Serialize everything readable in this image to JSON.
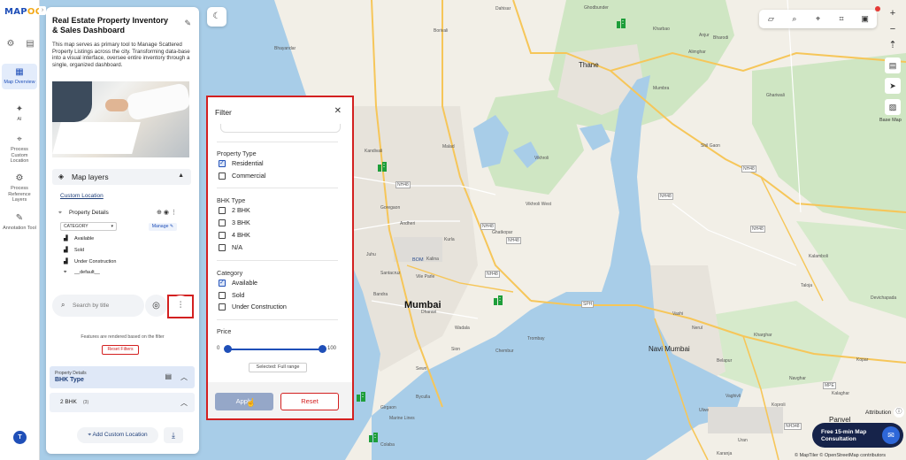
{
  "app": {
    "logo_main": "MAP",
    "logo_accent": "OG"
  },
  "rail": {
    "items": [
      {
        "label": "Map Overview",
        "icon": "map-icon"
      },
      {
        "label": "AI",
        "icon": "ai-icon"
      },
      {
        "label": "Process Custom Location",
        "icon": "location-icon"
      },
      {
        "label": "Process Reference Layers",
        "icon": "layers-process-icon"
      },
      {
        "label": "Annotation Tool",
        "icon": "annotation-icon"
      }
    ],
    "avatar": "T"
  },
  "panel": {
    "title": "Real Estate Property Inventory & Sales Dashboard",
    "description": "This map serves as primary tool to Manage Scattered Property Listings across the city. Transforming data-base into a visual interface, oversee entire inventory through a single, organized dashboard.",
    "map_layers_label": "Map layers",
    "custom_location_label": "Custom Location",
    "layer_name": "Property Details",
    "category_select": "CATEGORY",
    "manage_label": "Manage",
    "legend": [
      "Available",
      "Sold",
      "Under Construction",
      "__default__"
    ],
    "search_placeholder": "Search by title",
    "features_note": "Features are rendered based on the filter",
    "reset_filters_label": "Reset Filters",
    "property_details_small": "Property Details",
    "bhk_type_label": "BHK Type",
    "bhk_row_label": "2 BHK",
    "bhk_row_count": "(3)",
    "add_custom_location_label": "Add Custom Location"
  },
  "filter": {
    "title": "Filter",
    "groups": [
      {
        "label": "Property Type",
        "options": [
          {
            "label": "Residential",
            "checked": true
          },
          {
            "label": "Commercial",
            "checked": false
          }
        ]
      },
      {
        "label": "BHK Type",
        "options": [
          {
            "label": "2 BHK",
            "checked": false
          },
          {
            "label": "3 BHK",
            "checked": false
          },
          {
            "label": "4 BHK",
            "checked": false
          },
          {
            "label": "N/A",
            "checked": false
          }
        ]
      },
      {
        "label": "Category",
        "options": [
          {
            "label": "Available",
            "checked": true
          },
          {
            "label": "Sold",
            "checked": false
          },
          {
            "label": "Under Construction",
            "checked": false
          }
        ]
      }
    ],
    "price_label": "Price",
    "price_min": "0",
    "price_max": "100",
    "price_range": [
      0,
      100
    ],
    "selected_range": "Selected: Full range",
    "apply_label": "Apply",
    "reset_label": "Reset"
  },
  "map": {
    "cities": [
      {
        "name": "Thane",
        "big": false
      },
      {
        "name": "Mumbai",
        "big": true
      },
      {
        "name": "Navi Mumbai",
        "big": false
      },
      {
        "name": "Panvel",
        "big": false
      }
    ],
    "places": [
      "Dahisar",
      "Borivali",
      "Ghodbunder",
      "Kharbao",
      "Anjur",
      "Bharodi",
      "Alimghar",
      "Mumbra",
      "Ghariwali",
      "Shil Gaon",
      "Kandivali",
      "Malad",
      "Bhayandar",
      "Goregaon",
      "Vikhroli",
      "Vikhroli West",
      "Ghatkopar",
      "Kurla",
      "Dharavi",
      "Wadala",
      "Vashi",
      "Nerul",
      "Kharghar",
      "Taloja",
      "Kalamboli",
      "Devichapada",
      "Ulwe",
      "Uran",
      "Vaghivli",
      "Belapur",
      "Koproli",
      "Navghar",
      "Kalaghar",
      "Kopar",
      "Karanja",
      "Sewri",
      "Colaba",
      "Marine Lines",
      "Byculla",
      "Girgaon",
      "Kalina",
      "Bandra",
      "Santacruz",
      "Andheri",
      "Juhu",
      "Vile Parle",
      "Sion",
      "Chembur",
      "Trombay"
    ],
    "road_badges": [
      "NH48",
      "NH48",
      "NH48",
      "NH48",
      "NH48",
      "NH48",
      "NH48",
      "SPH",
      "MPE",
      "NH348"
    ],
    "airport_label": "BOM",
    "colors": {
      "water": "#a8cde8",
      "land": "#f2efe7",
      "urban": "#e6e3dd",
      "green": "#cfe6c3",
      "road": "#f6c659",
      "accent": "#1f4fb8",
      "marker": "#1e9e3a",
      "danger": "#d32020"
    }
  },
  "map_controls": {
    "base_map_label": "Base Map",
    "attribution_label": "Attribution",
    "consultation_label_line1": "Free 15-min Map",
    "consultation_label_line2": "Consultation",
    "copyright": "© MapTiler © OpenStreetMap contributors"
  }
}
